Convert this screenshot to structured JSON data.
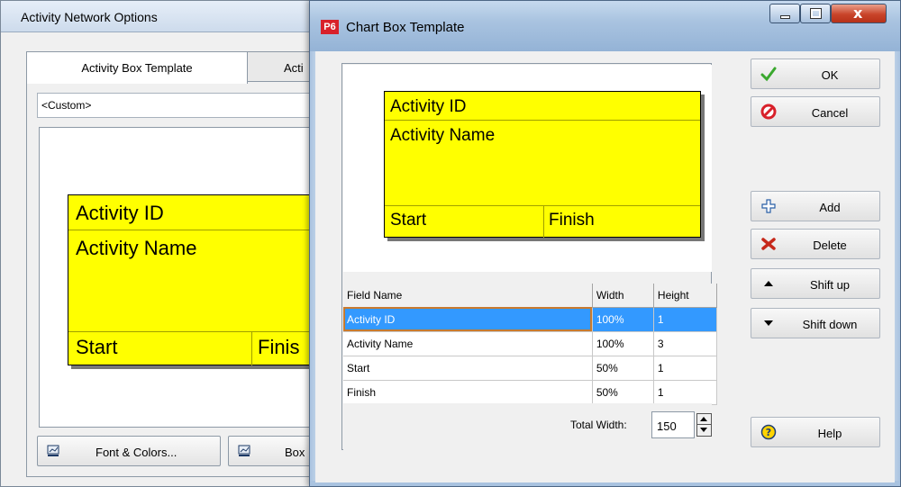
{
  "back_window": {
    "title": "Activity Network Options",
    "tabs": [
      "Activity Box Template",
      "Acti"
    ],
    "template_select": "<Custom>",
    "preview": {
      "field1": "Activity ID",
      "field2": "Activity Name",
      "field3": "Start",
      "field4": "Finis"
    },
    "buttons": {
      "font_colors": "Font & Colors...",
      "box": "Box"
    }
  },
  "front_window": {
    "title": "Chart Box Template",
    "logo": "P6",
    "close_glyph": "x",
    "preview": {
      "field1": "Activity ID",
      "field2": "Activity Name",
      "field3": "Start",
      "field4": "Finish"
    },
    "table": {
      "headers": [
        "Field Name",
        "Width",
        "Height"
      ],
      "rows": [
        [
          "Activity ID",
          "100%",
          "1"
        ],
        [
          "Activity Name",
          "100%",
          "3"
        ],
        [
          "Start",
          "50%",
          "1"
        ],
        [
          "Finish",
          "50%",
          "1"
        ]
      ],
      "selected_row": 0
    },
    "total_width_label": "Total Width:",
    "total_width_value": "150",
    "buttons": {
      "ok": "OK",
      "cancel": "Cancel",
      "add": "Add",
      "delete": "Delete",
      "shift_up": "Shift up",
      "shift_down": "Shift down",
      "help": "Help"
    },
    "icons": {
      "ok": "check-icon",
      "cancel": "no-entry-icon",
      "add": "plus-icon",
      "delete": "x-icon",
      "shift_up": "triangle-up-icon",
      "shift_down": "triangle-down-icon",
      "help": "help-icon"
    }
  },
  "colors": {
    "box_fill": "#ffff00",
    "selection": "#3399ff",
    "ok_green": "#3aa82e",
    "cancel_red": "#d8202a",
    "logo_red": "#d8202a"
  }
}
